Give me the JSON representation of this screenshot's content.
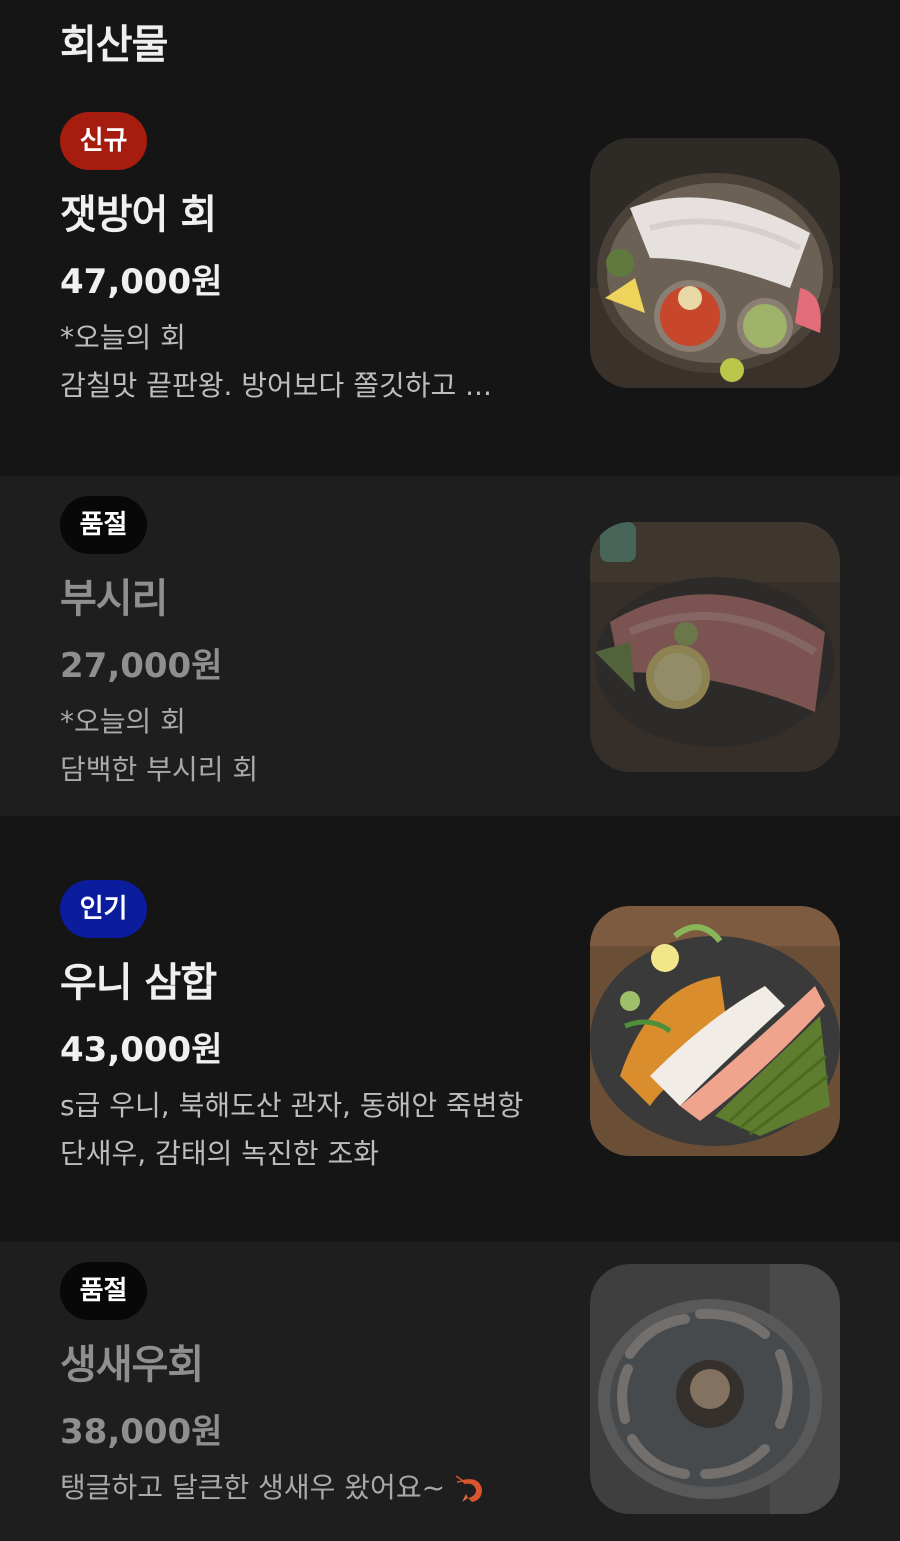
{
  "section": {
    "title": "회산물"
  },
  "items": [
    {
      "badge": "신규",
      "badge_kind": "new",
      "name": "잿방어 회",
      "price": "47,000원",
      "desc": [
        "*오늘의 회",
        "감칠맛 끝판왕. 방어보다 쫄깃하고 ..."
      ],
      "photo_icon": "sashimi-plate-photo"
    },
    {
      "badge": "품절",
      "badge_kind": "sold",
      "name": "부시리",
      "price": "27,000원",
      "desc": [
        "*오늘의 회",
        "담백한 부시리 회"
      ],
      "photo_icon": "sashimi-plate-photo"
    },
    {
      "badge": "인기",
      "badge_kind": "hot",
      "name": "우니 삼합",
      "price": "43,000원",
      "desc": [
        "s급 우니, 북해도산 관자, 동해안 죽변항",
        "단새우, 감태의 녹진한 조화"
      ],
      "photo_icon": "uni-platter-photo"
    },
    {
      "badge": "품절",
      "badge_kind": "sold",
      "name": "생새우회",
      "price": "38,000원",
      "desc": [
        "탱글하고 달큰한 생새우 왔어요~"
      ],
      "desc_emoji": "shrimp-icon",
      "photo_icon": "raw-shrimp-photo"
    }
  ],
  "colors": {
    "background": "#151516",
    "alt_background": "#1e1e1f",
    "badge_new": "#a61d10",
    "badge_sold": "#080808",
    "badge_hot": "#0b1c9c"
  }
}
